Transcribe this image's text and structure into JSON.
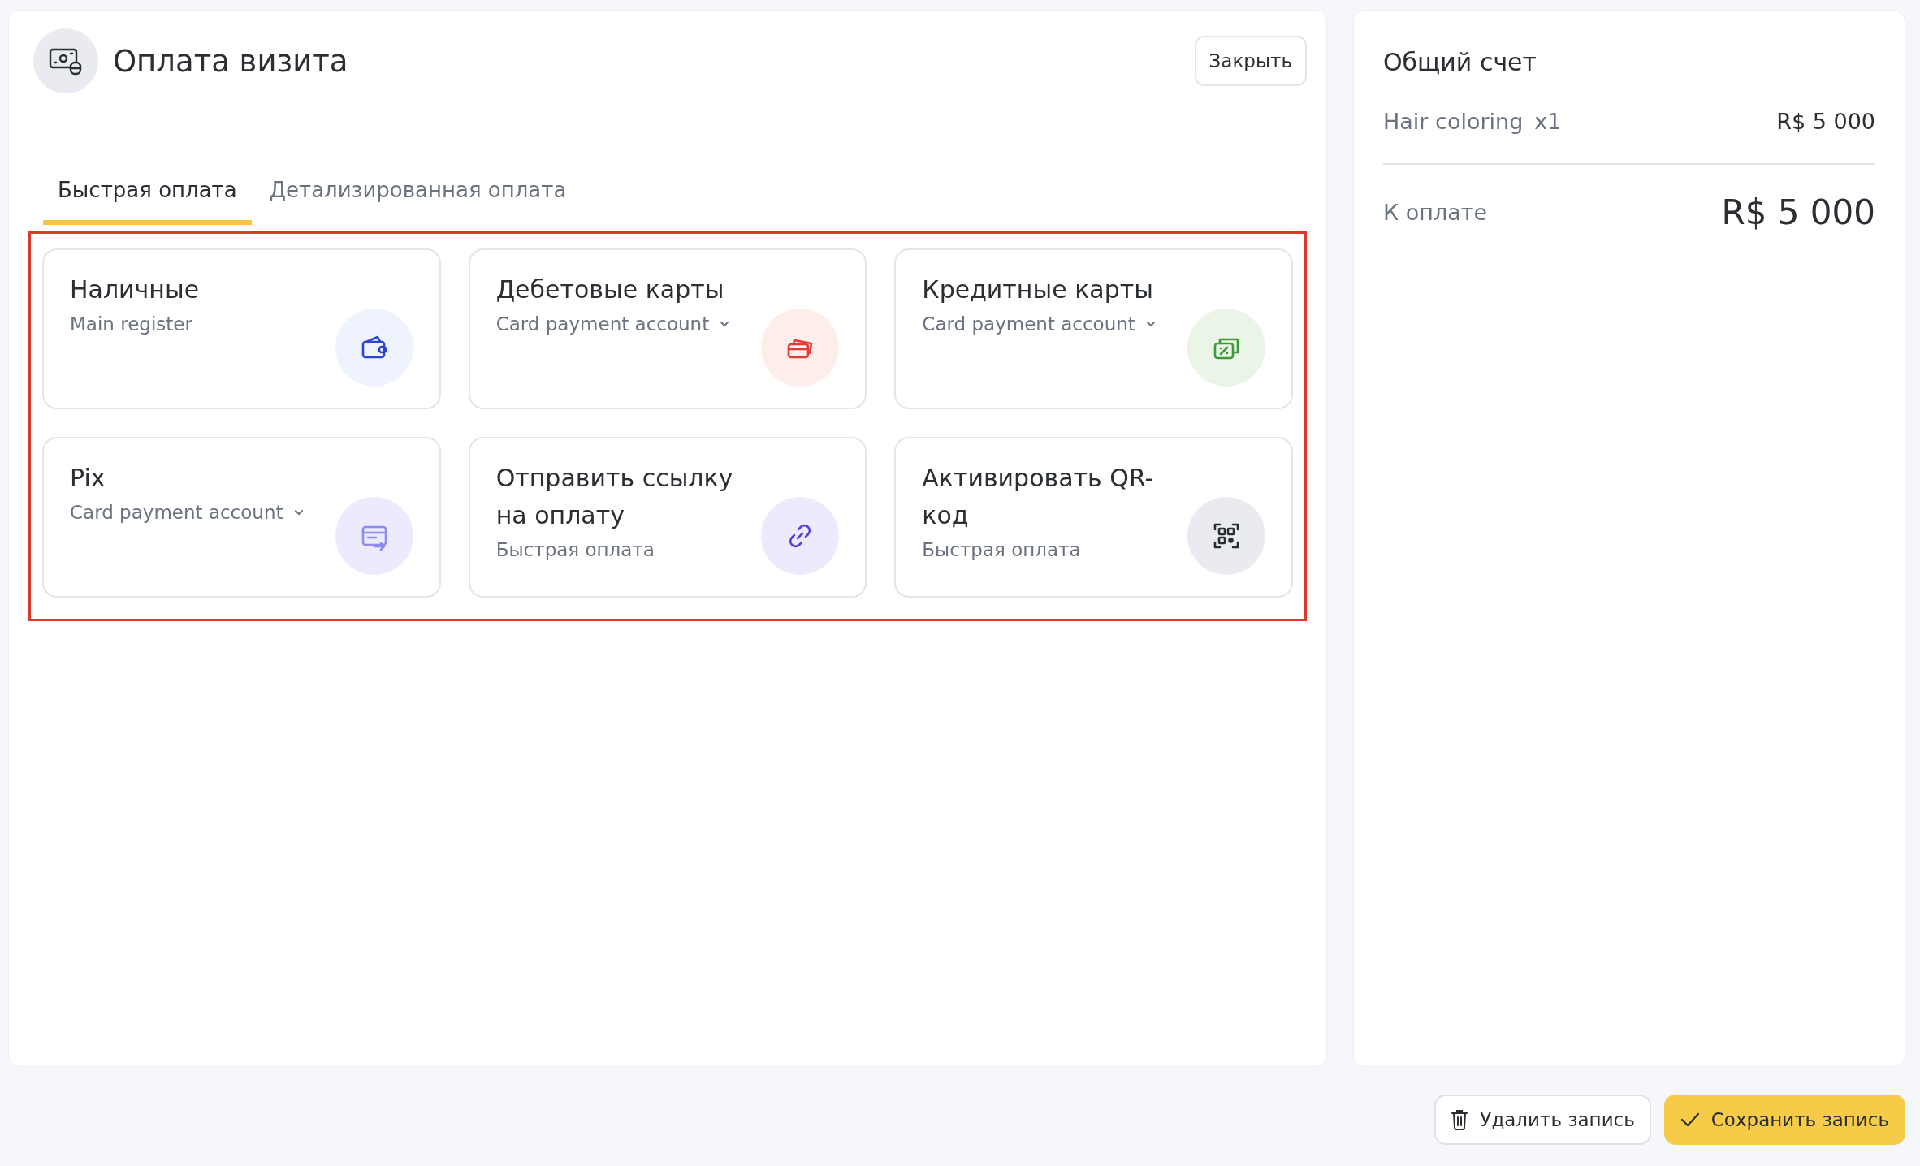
{
  "header": {
    "title": "Оплата визита",
    "close_button": "Закрыть"
  },
  "tabs": [
    {
      "label": "Быстрая оплата",
      "selected": true
    },
    {
      "label": "Детализированная оплата",
      "selected": false
    }
  ],
  "payment_methods": {
    "highlighted": true,
    "items": [
      {
        "title": "Наличные",
        "subtitle": "Main register",
        "dropdown": false,
        "kind": "wallet"
      },
      {
        "title": "Дебетовые карты",
        "subtitle": "Card payment account",
        "dropdown": true,
        "kind": "cards"
      },
      {
        "title": "Кредитные карты",
        "subtitle": "Card payment account",
        "dropdown": true,
        "kind": "credit"
      },
      {
        "title": "Pix",
        "subtitle": "Card payment account",
        "dropdown": true,
        "kind": "transfer"
      },
      {
        "title": "Отправить ссылку на оплату",
        "subtitle": "Быстрая оплата",
        "dropdown": false,
        "kind": "link"
      },
      {
        "title": "Активировать QR-код",
        "subtitle": "Быстрая оплата",
        "dropdown": false,
        "kind": "qr"
      }
    ]
  },
  "bill": {
    "title": "Общий счет",
    "items": [
      {
        "name": "Hair coloring",
        "qty": "x1",
        "price": "R$ 5 000"
      }
    ],
    "total_label": "К оплате",
    "total": "R$ 5 000"
  },
  "actions": {
    "delete": "Удалить запись",
    "save": "Сохранить запись"
  }
}
